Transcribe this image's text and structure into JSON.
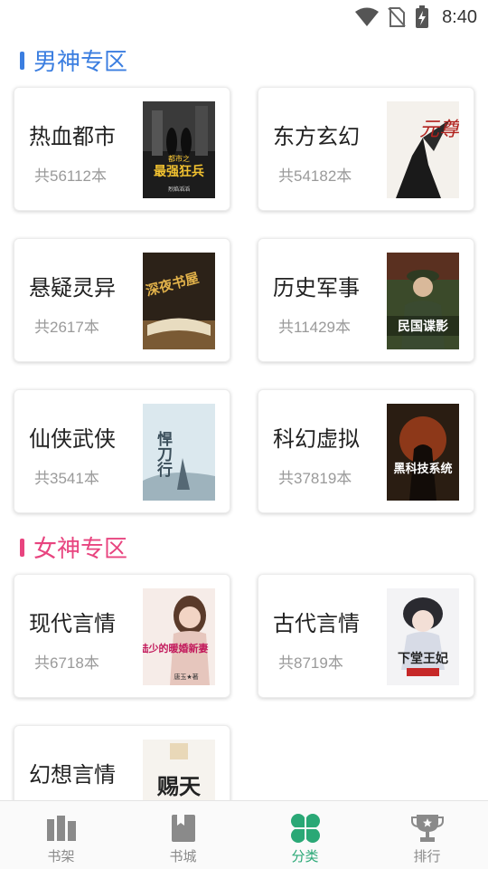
{
  "status": {
    "time": "8:40"
  },
  "sections": {
    "male": {
      "title": "男神专区"
    },
    "female": {
      "title": "女神专区"
    }
  },
  "categories": [
    {
      "name": "热血都市",
      "count": "共56112本"
    },
    {
      "name": "东方玄幻",
      "count": "共54182本"
    },
    {
      "name": "悬疑灵异",
      "count": "共2617本"
    },
    {
      "name": "历史军事",
      "count": "共11429本"
    },
    {
      "name": "仙侠武侠",
      "count": "共3541本"
    },
    {
      "name": "科幻虚拟",
      "count": "共37819本"
    },
    {
      "name": "现代言情",
      "count": "共6718本"
    },
    {
      "name": "古代言情",
      "count": "共8719本"
    },
    {
      "name": "幻想言情",
      "count": ""
    }
  ],
  "covers": [
    {
      "text": "最强狂兵",
      "sub": "都市之",
      "author": "烈焰滔滔",
      "bg": "#1c1c1c",
      "fg": "#f2c230"
    },
    {
      "text": "元尊",
      "bg": "#f4f1ec",
      "fg": "#b1221e"
    },
    {
      "text": "深夜书屋",
      "bg": "#2c2218",
      "fg": "#e2b24a"
    },
    {
      "text": "民国谍影",
      "bg": "#3b4a2a",
      "fg": "#ffffff"
    },
    {
      "text": "悍刀行",
      "bg": "#dbe8ee",
      "fg": "#3a4e5a"
    },
    {
      "text": "黑科技系统",
      "bg": "#2a1d12",
      "fg": "#ffffff"
    },
    {
      "text": "陆少的暖婚新妻",
      "author": "唐玉★著",
      "bg": "#f6ece8",
      "fg": "#c2185b"
    },
    {
      "text": "下堂王妃",
      "bg": "#f3f3f5",
      "fg": "#222222"
    },
    {
      "text": "赐天",
      "bg": "#f6f3ee",
      "fg": "#222222"
    }
  ],
  "tabs": [
    {
      "label": "书架",
      "icon": "bookshelf-icon"
    },
    {
      "label": "书城",
      "icon": "bookstore-icon"
    },
    {
      "label": "分类",
      "icon": "category-icon",
      "active": true
    },
    {
      "label": "排行",
      "icon": "ranking-icon"
    }
  ],
  "colors": {
    "male_accent": "#3b7ee0",
    "female_accent": "#e8447f",
    "active_tab": "#2aa876",
    "inactive_tab": "#8a8a8a"
  }
}
